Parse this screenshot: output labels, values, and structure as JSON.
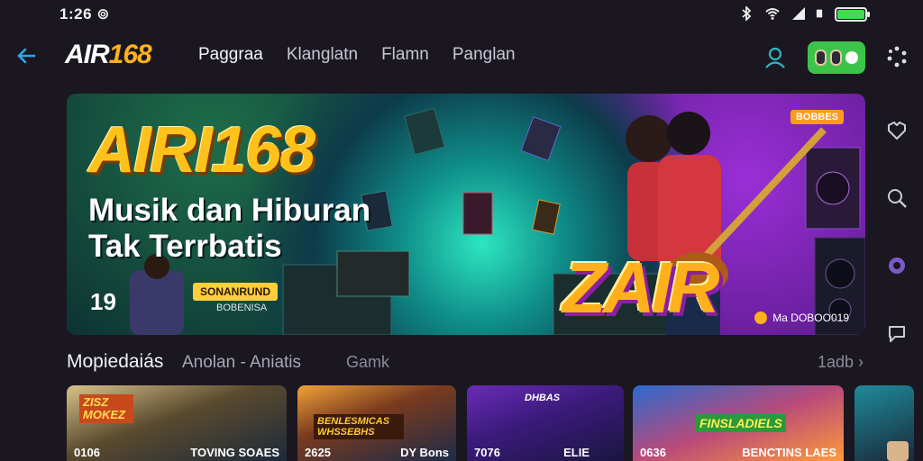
{
  "status_bar": {
    "time": "1:26 ⊚"
  },
  "header": {
    "logo_white": "AIR",
    "logo_orange": "168",
    "nav": [
      "Paggraa",
      "Klanglatn",
      "Flamn",
      "Panglan"
    ]
  },
  "hero": {
    "title": "AIRI168",
    "subtitle_line1": "Musik dan Hiburan",
    "subtitle_line2": "Tak Terrbatis",
    "badge_number": "19",
    "chip_text": "SONANRUND",
    "chip_sub": "BOBENISA",
    "tag": "BOBBES",
    "zair_text": "ZAIR",
    "footer_text": "Ma DOBOO019"
  },
  "section": {
    "title": "Mopiedaiás",
    "subtitle": "Anolan - Aniatis",
    "tab": "Gamk",
    "more": "1adb ›"
  },
  "cards": [
    {
      "banner": "ZISZ MOKEZ",
      "left": "0106",
      "right": "TOVING SOAES"
    },
    {
      "banner": "BENLESMICAS WHSSEBHS",
      "left": "2625",
      "right": "DY Bons"
    },
    {
      "banner": "DHBAS",
      "left": "7076",
      "right": "ELIE"
    },
    {
      "banner": "FINSLADIELS",
      "left": "0636",
      "right": "BENCTINS  LAES"
    },
    {
      "banner": "",
      "left": "",
      "right": ""
    }
  ],
  "colors": {
    "accent": "#ffb21c",
    "green": "#3cc44a",
    "back": "#2aa7e8"
  },
  "icons": [
    "back-arrow-icon",
    "user-icon",
    "more-dots-icon",
    "heart-icon",
    "search-icon",
    "settings-icon",
    "chat-icon"
  ]
}
